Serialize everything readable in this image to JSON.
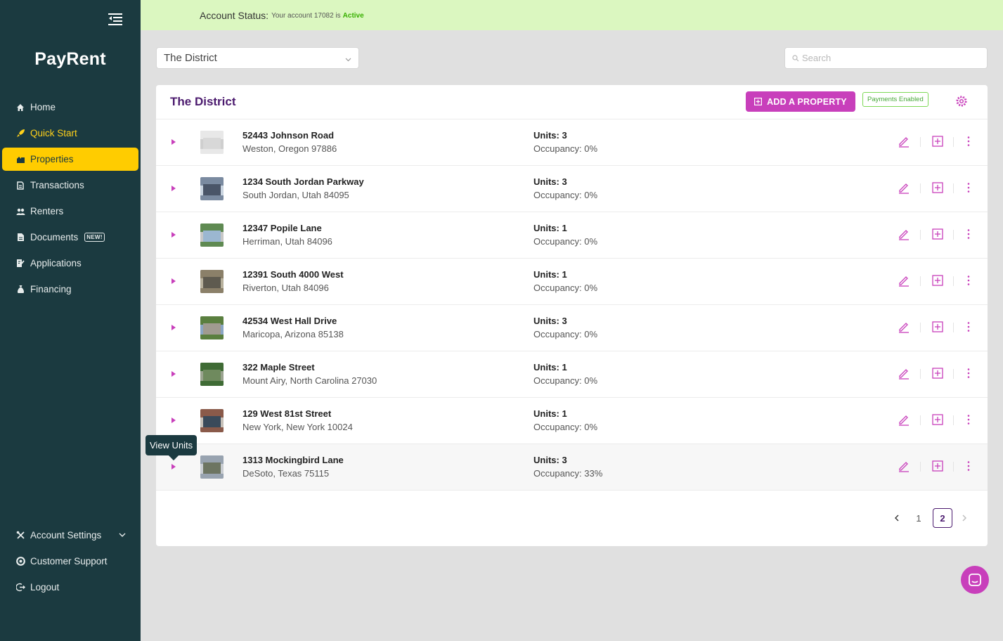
{
  "sidebar": {
    "logo": "PayRent",
    "items": [
      {
        "label": "Home",
        "icon": "home-icon"
      },
      {
        "label": "Quick Start",
        "icon": "rocket-icon"
      },
      {
        "label": "Properties",
        "icon": "buildings-icon"
      },
      {
        "label": "Transactions",
        "icon": "money-icon"
      },
      {
        "label": "Renters",
        "icon": "users-icon"
      },
      {
        "label": "Documents",
        "icon": "document-icon",
        "badge": "NEW!"
      },
      {
        "label": "Applications",
        "icon": "application-icon"
      },
      {
        "label": "Financing",
        "icon": "money-bag-icon"
      }
    ],
    "bottom_items": [
      {
        "label": "Account Settings",
        "icon": "tools-icon"
      },
      {
        "label": "Customer Support",
        "icon": "support-icon"
      },
      {
        "label": "Logout",
        "icon": "logout-icon"
      }
    ]
  },
  "status": {
    "label": "Account Status:",
    "text": "Your account 17082 is",
    "state": "Active"
  },
  "property_select": {
    "value": "The District"
  },
  "search": {
    "placeholder": "Search"
  },
  "card": {
    "title": "The District",
    "add_button": "ADD A PROPERTY",
    "payments_badge": "Payments Enabled"
  },
  "properties": [
    {
      "address": "52443 Johnson Road",
      "city": "Weston, Oregon 97886",
      "units": "Units: 3",
      "occupancy": "Occupancy: 0%"
    },
    {
      "address": "1234 South Jordan Parkway",
      "city": "South Jordan, Utah 84095",
      "units": "Units: 3",
      "occupancy": "Occupancy: 0%"
    },
    {
      "address": "12347 Popile Lane",
      "city": "Herriman, Utah 84096",
      "units": "Units: 1",
      "occupancy": "Occupancy: 0%"
    },
    {
      "address": "12391 South 4000 West",
      "city": "Riverton, Utah 84096",
      "units": "Units: 1",
      "occupancy": "Occupancy: 0%"
    },
    {
      "address": "42534 West Hall Drive",
      "city": "Maricopa, Arizona 85138",
      "units": "Units: 3",
      "occupancy": "Occupancy: 0%"
    },
    {
      "address": "322 Maple Street",
      "city": "Mount Airy, North Carolina 27030",
      "units": "Units: 1",
      "occupancy": "Occupancy: 0%"
    },
    {
      "address": "129 West 81st Street",
      "city": "New York, New York 10024",
      "units": "Units: 1",
      "occupancy": "Occupancy: 0%"
    },
    {
      "address": "1313 Mockingbird Lane",
      "city": "DeSoto, Texas 75115",
      "units": "Units: 3",
      "occupancy": "Occupancy: 33%"
    }
  ],
  "tooltip": "View Units",
  "pagination": {
    "pages": [
      "1",
      "2"
    ],
    "current": "2"
  },
  "colors": {
    "sidebar_bg": "#1b3a40",
    "accent_yellow": "#ffcc00",
    "brand_magenta": "#c83fbb",
    "title_purple": "#4b1a6e",
    "status_bg": "#dbf7c0",
    "active_green": "#38b000"
  }
}
